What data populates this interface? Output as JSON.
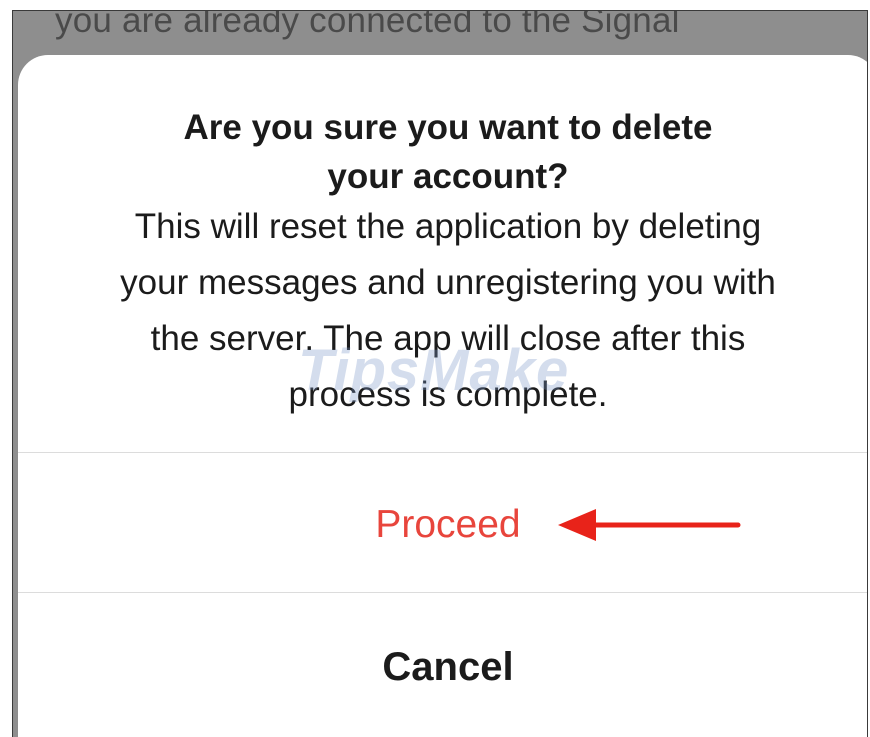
{
  "background": {
    "text": "you are already connected to the Signal"
  },
  "dialog": {
    "title_lines": [
      "Are you sure you want to delete",
      "your account?"
    ],
    "message_lines": [
      "This will reset the application by deleting",
      "your messages and unregistering you with",
      "the server. The app will close after this",
      "process is complete."
    ],
    "proceed_label": "Proceed",
    "cancel_label": "Cancel"
  },
  "watermark": {
    "text": "TipsMake"
  },
  "annotation": {
    "arrow_icon": "left-arrow-icon",
    "color": "#e8231a"
  },
  "colors": {
    "destructive": "#e8453c",
    "text": "#1b1b1b",
    "overlay": "#8e8e8e",
    "sheet": "#ffffff",
    "divider": "#dcdcdc"
  }
}
